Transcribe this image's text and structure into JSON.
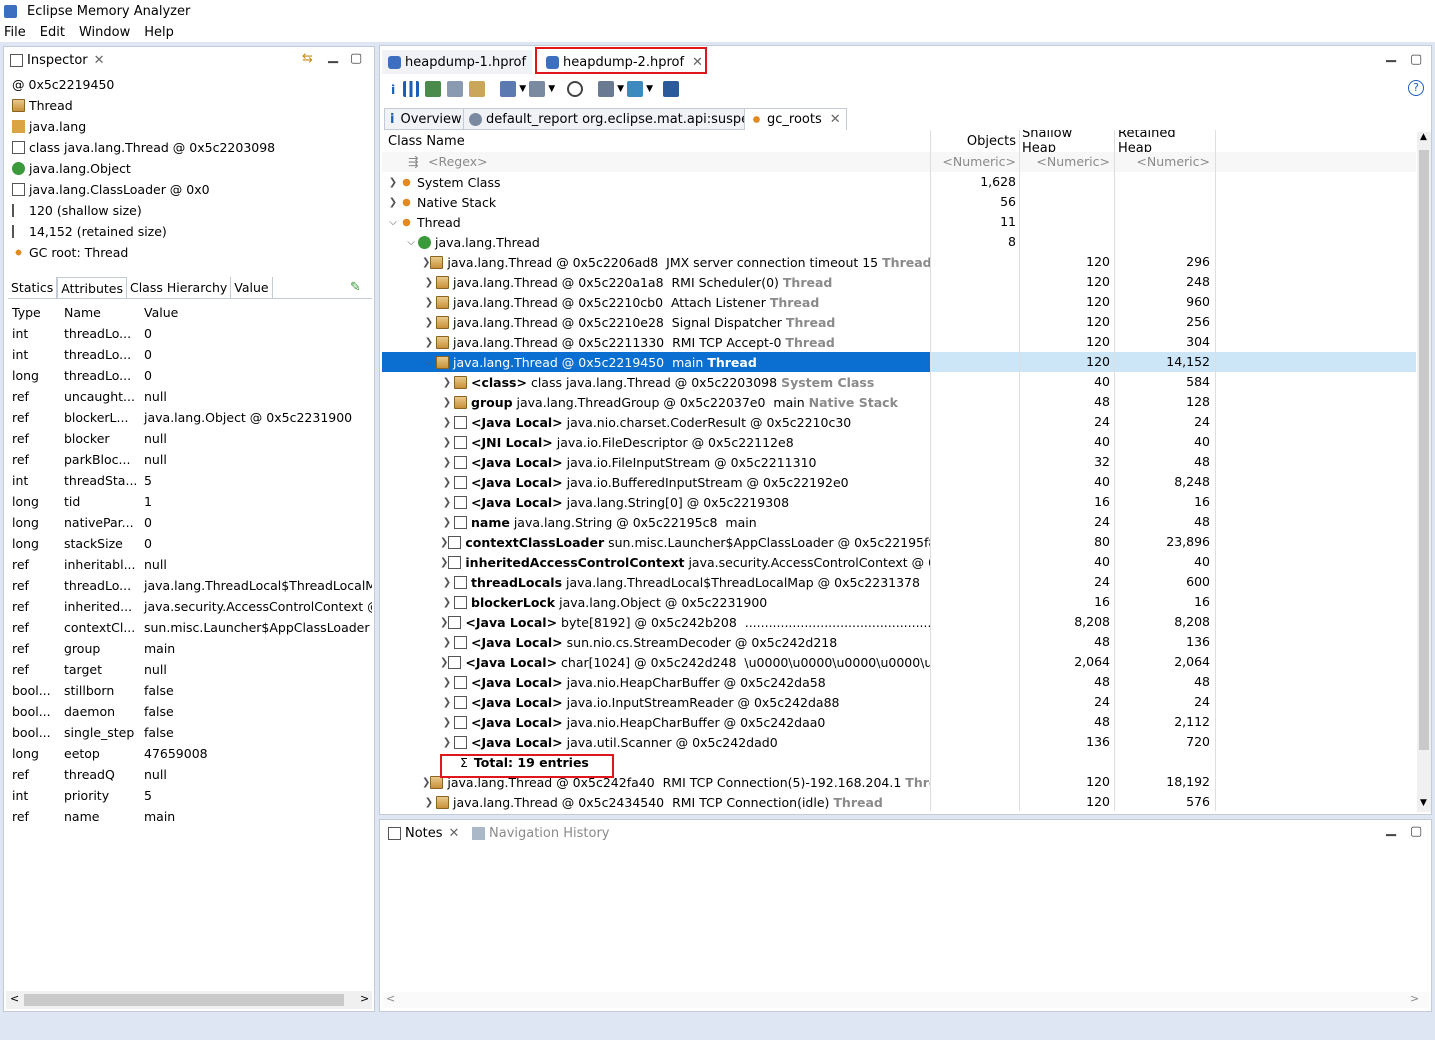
{
  "window": {
    "title": "Eclipse Memory Analyzer"
  },
  "menu": [
    "File",
    "Edit",
    "Window",
    "Help"
  ],
  "inspector": {
    "tab_label": "Inspector",
    "rows": [
      "0x5c2219450",
      "Thread",
      "java.lang",
      "class java.lang.Thread @ 0x5c2203098",
      "java.lang.Object",
      "java.lang.ClassLoader @ 0x0",
      "120 (shallow size)",
      "14,152 (retained size)",
      "GC root: Thread"
    ],
    "address_prefix": "@",
    "subtabs": [
      "Statics",
      "Attributes",
      "Class Hierarchy",
      "Value"
    ],
    "columns": [
      "Type",
      "Name",
      "Value"
    ],
    "attributes": [
      [
        "int",
        "threadLo...",
        "0"
      ],
      [
        "int",
        "threadLo...",
        "0"
      ],
      [
        "long",
        "threadLo...",
        "0"
      ],
      [
        "ref",
        "uncaught...",
        "null"
      ],
      [
        "ref",
        "blockerL...",
        "java.lang.Object @ 0x5c2231900"
      ],
      [
        "ref",
        "blocker",
        "null"
      ],
      [
        "ref",
        "parkBloc...",
        "null"
      ],
      [
        "int",
        "threadSta...",
        "5"
      ],
      [
        "long",
        "tid",
        "1"
      ],
      [
        "long",
        "nativePar...",
        "0"
      ],
      [
        "long",
        "stackSize",
        "0"
      ],
      [
        "ref",
        "inheritabl...",
        "null"
      ],
      [
        "ref",
        "threadLo...",
        "java.lang.ThreadLocal$ThreadLocalMa..."
      ],
      [
        "ref",
        "inherited...",
        "java.security.AccessControlContext @ 0..."
      ],
      [
        "ref",
        "contextCl...",
        "sun.misc.Launcher$AppClassLoader @ ..."
      ],
      [
        "ref",
        "group",
        "main"
      ],
      [
        "ref",
        "target",
        "null"
      ],
      [
        "bool...",
        "stillborn",
        "false"
      ],
      [
        "bool...",
        "daemon",
        "false"
      ],
      [
        "bool...",
        "single_step",
        "false"
      ],
      [
        "long",
        "eetop",
        "47659008"
      ],
      [
        "ref",
        "threadQ",
        "null"
      ],
      [
        "int",
        "priority",
        "5"
      ],
      [
        "ref",
        "name",
        "main"
      ]
    ]
  },
  "editor": {
    "tabs": [
      "heapdump-1.hprof",
      "heapdump-2.hprof"
    ],
    "inner_tabs": [
      "Overview",
      "default_report  org.eclipse.mat.api:suspects",
      "gc_roots"
    ],
    "columns": [
      "Class Name",
      "Objects",
      "Shallow Heap",
      "Retained Heap"
    ],
    "filters": [
      "<Regex>",
      "<Numeric>",
      "<Numeric>",
      "<Numeric>"
    ],
    "rows": [
      {
        "i": 0,
        "a": ">",
        "ic": "roots",
        "p": "",
        "n": "System Class",
        "t": "",
        "o": "1,628",
        "s": "",
        "r": ""
      },
      {
        "i": 0,
        "a": ">",
        "ic": "roots",
        "p": "",
        "n": "Native Stack",
        "t": "",
        "o": "56",
        "s": "",
        "r": ""
      },
      {
        "i": 0,
        "a": "v",
        "ic": "roots",
        "p": "",
        "n": "Thread",
        "t": "",
        "o": "11",
        "s": "",
        "r": ""
      },
      {
        "i": 1,
        "a": "v",
        "ic": "green",
        "p": "",
        "n": "java.lang.Thread",
        "t": "",
        "o": "8",
        "s": "",
        "r": ""
      },
      {
        "i": 2,
        "a": ">",
        "ic": "obj",
        "p": "",
        "n": "java.lang.Thread @ 0x5c2206ad8  JMX server connection timeout 15",
        "t": "Thread",
        "o": "",
        "s": "120",
        "r": "296"
      },
      {
        "i": 2,
        "a": ">",
        "ic": "obj",
        "p": "",
        "n": "java.lang.Thread @ 0x5c220a1a8  RMI Scheduler(0)",
        "t": "Thread",
        "o": "",
        "s": "120",
        "r": "248"
      },
      {
        "i": 2,
        "a": ">",
        "ic": "obj",
        "p": "",
        "n": "java.lang.Thread @ 0x5c2210cb0  Attach Listener",
        "t": "Thread",
        "o": "",
        "s": "120",
        "r": "960"
      },
      {
        "i": 2,
        "a": ">",
        "ic": "obj",
        "p": "",
        "n": "java.lang.Thread @ 0x5c2210e28  Signal Dispatcher",
        "t": "Thread",
        "o": "",
        "s": "120",
        "r": "256"
      },
      {
        "i": 2,
        "a": ">",
        "ic": "obj",
        "p": "",
        "n": "java.lang.Thread @ 0x5c2211330  RMI TCP Accept-0",
        "t": "Thread",
        "o": "",
        "s": "120",
        "r": "304"
      },
      {
        "i": 2,
        "a": "v",
        "ic": "obj",
        "p": "",
        "n": "java.lang.Thread @ 0x5c2219450  main",
        "t": "Thread",
        "o": "",
        "s": "120",
        "r": "14,152",
        "sel": true
      },
      {
        "i": 3,
        "a": ">",
        "ic": "obj",
        "p": "<class>",
        "n": " class java.lang.Thread @ 0x5c2203098",
        "t": "System Class",
        "o": "",
        "s": "40",
        "r": "584"
      },
      {
        "i": 3,
        "a": ">",
        "ic": "obj",
        "p": "group",
        "n": " java.lang.ThreadGroup @ 0x5c22037e0  main",
        "t": "Native Stack",
        "o": "",
        "s": "48",
        "r": "128"
      },
      {
        "i": 3,
        "a": ">",
        "ic": "file",
        "p": "<Java Local>",
        "n": " java.nio.charset.CoderResult @ 0x5c2210c30",
        "t": "",
        "o": "",
        "s": "24",
        "r": "24"
      },
      {
        "i": 3,
        "a": ">",
        "ic": "file",
        "p": "<JNI Local>",
        "n": " java.io.FileDescriptor @ 0x5c22112e8",
        "t": "",
        "o": "",
        "s": "40",
        "r": "40"
      },
      {
        "i": 3,
        "a": ">",
        "ic": "file",
        "p": "<Java Local>",
        "n": " java.io.FileInputStream @ 0x5c2211310",
        "t": "",
        "o": "",
        "s": "32",
        "r": "48"
      },
      {
        "i": 3,
        "a": ">",
        "ic": "file",
        "p": "<Java Local>",
        "n": " java.io.BufferedInputStream @ 0x5c22192e0",
        "t": "",
        "o": "",
        "s": "40",
        "r": "8,248"
      },
      {
        "i": 3,
        "a": ">",
        "ic": "file",
        "p": "<Java Local>",
        "n": " java.lang.String[0] @ 0x5c2219308",
        "t": "",
        "o": "",
        "s": "16",
        "r": "16"
      },
      {
        "i": 3,
        "a": ">",
        "ic": "file",
        "p": "name",
        "n": " java.lang.String @ 0x5c22195c8  main",
        "t": "",
        "o": "",
        "s": "24",
        "r": "48"
      },
      {
        "i": 3,
        "a": ">",
        "ic": "file",
        "p": "contextClassLoader",
        "n": " sun.misc.Launcher$AppClassLoader @ 0x5c22195f8",
        "t": "",
        "o": "",
        "s": "80",
        "r": "23,896"
      },
      {
        "i": 3,
        "a": ">",
        "ic": "file",
        "p": "inheritedAccessControlContext",
        "n": " java.security.AccessControlContext @ 0x5c2",
        "t": "",
        "o": "",
        "s": "40",
        "r": "40"
      },
      {
        "i": 3,
        "a": ">",
        "ic": "file",
        "p": "threadLocals",
        "n": " java.lang.ThreadLocal$ThreadLocalMap @ 0x5c2231378",
        "t": "",
        "o": "",
        "s": "24",
        "r": "600"
      },
      {
        "i": 3,
        "a": ">",
        "ic": "file",
        "p": "blockerLock",
        "n": " java.lang.Object @ 0x5c2231900",
        "t": "",
        "o": "",
        "s": "16",
        "r": "16"
      },
      {
        "i": 3,
        "a": ">",
        "ic": "file",
        "p": "<Java Local>",
        "n": " byte[8192] @ 0x5c242b208  ..............................................................",
        "t": "",
        "o": "",
        "s": "8,208",
        "r": "8,208"
      },
      {
        "i": 3,
        "a": ">",
        "ic": "file",
        "p": "<Java Local>",
        "n": " sun.nio.cs.StreamDecoder @ 0x5c242d218",
        "t": "",
        "o": "",
        "s": "48",
        "r": "136"
      },
      {
        "i": 3,
        "a": ">",
        "ic": "file",
        "p": "<Java Local>",
        "n": " char[1024] @ 0x5c242d248  \\u0000\\u0000\\u0000\\u0000\\u0000",
        "t": "",
        "o": "",
        "s": "2,064",
        "r": "2,064"
      },
      {
        "i": 3,
        "a": ">",
        "ic": "file",
        "p": "<Java Local>",
        "n": " java.nio.HeapCharBuffer @ 0x5c242da58",
        "t": "",
        "o": "",
        "s": "48",
        "r": "48"
      },
      {
        "i": 3,
        "a": ">",
        "ic": "file",
        "p": "<Java Local>",
        "n": " java.io.InputStreamReader @ 0x5c242da88",
        "t": "",
        "o": "",
        "s": "24",
        "r": "24"
      },
      {
        "i": 3,
        "a": ">",
        "ic": "file",
        "p": "<Java Local>",
        "n": " java.nio.HeapCharBuffer @ 0x5c242daa0",
        "t": "",
        "o": "",
        "s": "48",
        "r": "2,112"
      },
      {
        "i": 3,
        "a": ">",
        "ic": "file",
        "p": "<Java Local>",
        "n": " java.util.Scanner @ 0x5c242dad0",
        "t": "",
        "o": "",
        "s": "136",
        "r": "720"
      },
      {
        "i": 3,
        "a": "",
        "ic": "sigma",
        "p": "Total: 19 entries",
        "n": "",
        "t": "",
        "o": "",
        "s": "",
        "r": ""
      },
      {
        "i": 2,
        "a": ">",
        "ic": "obj",
        "p": "",
        "n": "java.lang.Thread @ 0x5c242fa40  RMI TCP Connection(5)-192.168.204.1",
        "t": "Thread",
        "o": "",
        "s": "120",
        "r": "18,192"
      },
      {
        "i": 2,
        "a": ">",
        "ic": "obj",
        "p": "",
        "n": "java.lang.Thread @ 0x5c2434540  RMI TCP Connection(idle)",
        "t": "Thread",
        "o": "",
        "s": "120",
        "r": "576"
      }
    ]
  },
  "notes": {
    "tab_label": "Notes",
    "nav_label": "Navigation History"
  },
  "colors": {
    "highlight": "#e0161b",
    "selection": "#0b6fd1"
  }
}
